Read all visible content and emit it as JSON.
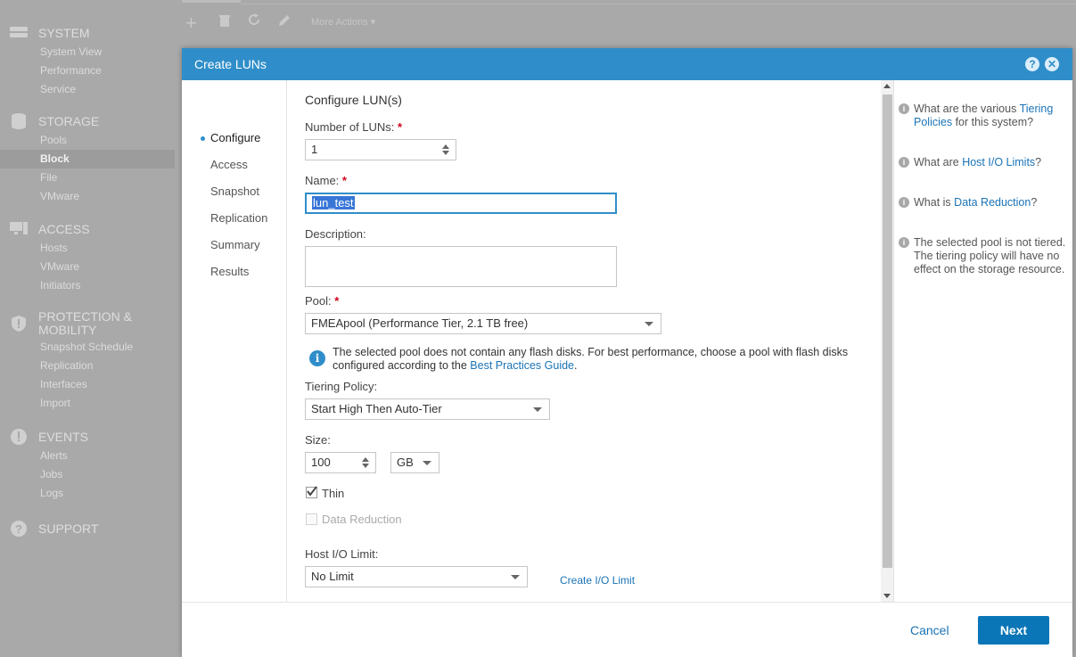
{
  "nav": {
    "system": {
      "title": "SYSTEM",
      "items": [
        "System View",
        "Performance",
        "Service"
      ]
    },
    "storage": {
      "title": "STORAGE",
      "items": [
        "Pools",
        "Block",
        "File",
        "VMware"
      ],
      "active": "Block"
    },
    "access": {
      "title": "ACCESS",
      "items": [
        "Hosts",
        "VMware",
        "Initiators"
      ]
    },
    "protection": {
      "title_line1": "PROTECTION &",
      "title_line2": "MOBILITY",
      "items": [
        "Snapshot Schedule",
        "Replication",
        "Interfaces",
        "Import"
      ]
    },
    "events": {
      "title": "EVENTS",
      "items": [
        "Alerts",
        "Jobs",
        "Logs"
      ]
    },
    "support": {
      "title": "SUPPORT"
    }
  },
  "toolbar": {
    "more_actions": "More Actions"
  },
  "modal": {
    "title": "Create LUNs",
    "help_btn": "?",
    "close_btn": "✕",
    "steps": [
      "Configure",
      "Access",
      "Snapshot",
      "Replication",
      "Summary",
      "Results"
    ],
    "active_step": "Configure",
    "section_title": "Configure LUN(s)",
    "form": {
      "num_luns_label": "Number of LUNs:",
      "num_luns_value": "1",
      "name_label": "Name:",
      "name_value": "lun_test",
      "description_label": "Description:",
      "description_value": "",
      "pool_label": "Pool:",
      "pool_value": "FMEApool (Performance Tier, 2.1 TB free)",
      "pool_info_text": "The selected pool does not contain any flash disks. For best performance, choose a pool with flash disks configured according to the",
      "pool_info_link": "Best Practices Guide",
      "pool_info_end": ".",
      "tiering_label": "Tiering Policy:",
      "tiering_value": "Start High Then Auto-Tier",
      "size_label": "Size:",
      "size_value": "100",
      "size_unit": "GB",
      "thin_label": "Thin",
      "thin_checked": true,
      "data_reduction_label": "Data Reduction",
      "data_reduction_checked": false,
      "host_io_label": "Host I/O Limit:",
      "host_io_value": "No Limit",
      "create_io_link": "Create I/O Limit",
      "required_mark": "*"
    },
    "help": {
      "q1_pre": "What are the various",
      "q1_link": "Tiering Policies",
      "q1_post": "for this system?",
      "q2_pre": "What are",
      "q2_link": "Host I/O Limits",
      "q2_post": "?",
      "q3_pre": "What is",
      "q3_link": "Data Reduction",
      "q3_post": "?",
      "note": "The selected pool is not tiered. The tiering policy will have no effect on the storage resource."
    },
    "footer": {
      "cancel": "Cancel",
      "next": "Next"
    }
  },
  "colors": {
    "header": "#2f8ec9",
    "primary_button": "#0b76b7",
    "link": "#1a73b6",
    "required": "#d0021b"
  }
}
